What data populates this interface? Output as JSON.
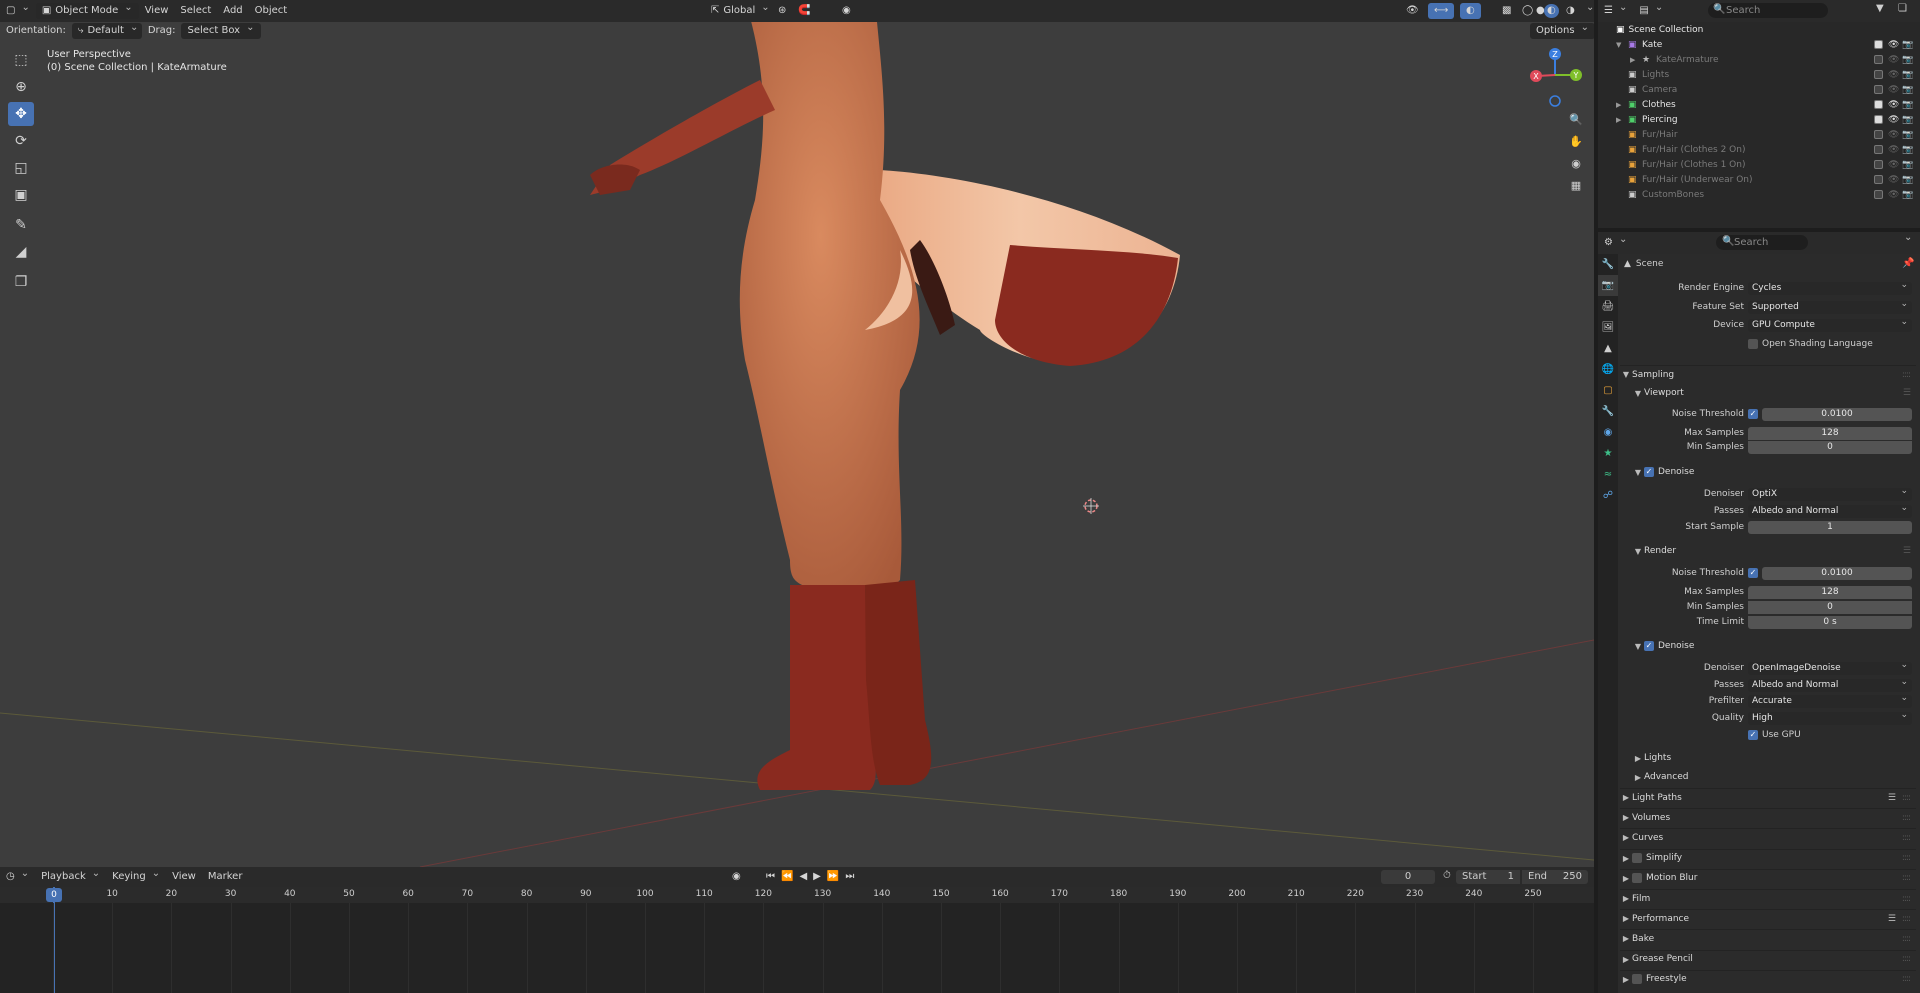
{
  "viewport": {
    "header": {
      "mode": "Object Mode",
      "menus": [
        "View",
        "Select",
        "Add",
        "Object"
      ],
      "transform_orientation": "Global",
      "search_placeholder": "Search"
    },
    "subheader": {
      "orientation_label": "Orientation:",
      "orientation_value": "Default",
      "drag_label": "Drag:",
      "drag_value": "Select Box",
      "options": "Options"
    },
    "overlay": {
      "perspective": "User Perspective",
      "collection_info": "(0) Scene Collection | KateArmature"
    },
    "gizmo": {
      "x": "X",
      "y": "Y",
      "z": "Z"
    }
  },
  "outliner": {
    "search_placeholder": "Search",
    "root": "Scene Collection",
    "rows": [
      {
        "label": "Kate",
        "active": true
      },
      {
        "label": "KateArmature",
        "active": false
      },
      {
        "label": "Lights",
        "active": false
      },
      {
        "label": "Camera",
        "active": false
      },
      {
        "label": "Clothes",
        "active": true
      },
      {
        "label": "Piercing",
        "active": true
      },
      {
        "label": "Fur/Hair",
        "active": false
      },
      {
        "label": "Fur/Hair (Clothes 2 On)",
        "active": false
      },
      {
        "label": "Fur/Hair (Clothes 1 On)",
        "active": false
      },
      {
        "label": "Fur/Hair (Underwear On)",
        "active": false
      },
      {
        "label": "CustomBones",
        "active": false
      }
    ]
  },
  "properties": {
    "search_placeholder": "Search",
    "context": "Scene",
    "render_engine_label": "Render Engine",
    "render_engine": "Cycles",
    "feature_set_label": "Feature Set",
    "feature_set": "Supported",
    "device_label": "Device",
    "device": "GPU Compute",
    "osl_label": "Open Shading Language",
    "sampling": "Sampling",
    "viewport_panel": "Viewport",
    "vp_noise_threshold_label": "Noise Threshold",
    "vp_noise_threshold": "0.0100",
    "vp_max_samples_label": "Max Samples",
    "vp_max_samples": "128",
    "vp_min_samples_label": "Min Samples",
    "vp_min_samples": "0",
    "vp_denoise": "Denoise",
    "vp_denoiser_label": "Denoiser",
    "vp_denoiser": "OptiX",
    "vp_passes_label": "Passes",
    "vp_passes": "Albedo and Normal",
    "vp_start_sample_label": "Start Sample",
    "vp_start_sample": "1",
    "render_panel": "Render",
    "r_noise_threshold_label": "Noise Threshold",
    "r_noise_threshold": "0.0100",
    "r_max_samples_label": "Max Samples",
    "r_max_samples": "128",
    "r_min_samples_label": "Min Samples",
    "r_min_samples": "0",
    "r_time_limit_label": "Time Limit",
    "r_time_limit": "0 s",
    "r_denoise": "Denoise",
    "r_denoiser_label": "Denoiser",
    "r_denoiser": "OpenImageDenoise",
    "r_passes_label": "Passes",
    "r_passes": "Albedo and Normal",
    "r_prefilter_label": "Prefilter",
    "r_prefilter": "Accurate",
    "r_quality_label": "Quality",
    "r_quality": "High",
    "r_use_gpu": "Use GPU",
    "lights": "Lights",
    "advanced": "Advanced",
    "sections": [
      "Light Paths",
      "Volumes",
      "Curves",
      "Simplify",
      "Motion Blur",
      "Film",
      "Performance",
      "Bake",
      "Grease Pencil",
      "Freestyle"
    ]
  },
  "timeline": {
    "menus": [
      "Playback",
      "Keying",
      "View",
      "Marker"
    ],
    "current_frame": "0",
    "start_label": "Start",
    "start": "1",
    "end_label": "End",
    "end": "250",
    "ticks": [
      "0",
      "10",
      "20",
      "30",
      "40",
      "50",
      "60",
      "70",
      "80",
      "90",
      "100",
      "110",
      "120",
      "130",
      "140",
      "150",
      "160",
      "170",
      "180",
      "190",
      "200",
      "210",
      "220",
      "230",
      "240",
      "250"
    ]
  }
}
